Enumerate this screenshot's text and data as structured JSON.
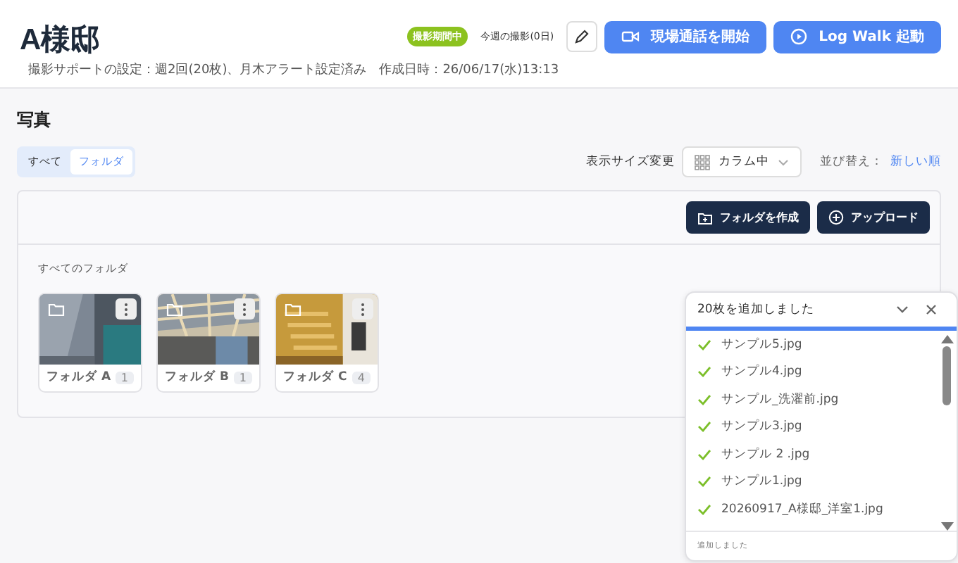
{
  "header": {
    "title": "A様邸",
    "status_badge": "撮影期間中",
    "week_badge": "今週の撮影(0日)",
    "subtitle": "撮影サポートの設定：週2回(20枚)、月木アラート設定済み　作成日時：26/06/17(水)13:13",
    "buttons": [
      {
        "label": "現場通話を開始",
        "kind": "video"
      },
      {
        "label": "Log Walk 起動",
        "kind": "play"
      }
    ]
  },
  "photos": {
    "title": "写真",
    "tabs": [
      {
        "label": "すべて",
        "selected": false
      },
      {
        "label": "フォルダ",
        "selected": true
      }
    ],
    "size_label": "表示サイズ変更",
    "size_select": "カラム中",
    "sort_label": "並び替え：",
    "sort_value": "新しい順",
    "actions": [
      {
        "label": "フォルダを作成",
        "kind": "folder"
      },
      {
        "label": "アップロード",
        "kind": "plus"
      }
    ],
    "folders_title": "すべてのフォルダ",
    "folders": [
      {
        "name": "フォルダ A",
        "count": "1"
      },
      {
        "name": "フォルダ B",
        "count": "1"
      },
      {
        "name": "フォルダ C",
        "count": "4"
      }
    ]
  },
  "upload": {
    "title": "20枚を追加しました",
    "level": 1,
    "files": [
      {
        "name": "サンプル5.jpg"
      },
      {
        "name": "サンプル4.jpg"
      },
      {
        "name": "サンプル_洗濯前.jpg"
      },
      {
        "name": "サンプル3.jpg"
      },
      {
        "name": "サンプル 2 .jpg"
      },
      {
        "name": "サンプル1.jpg"
      },
      {
        "name": "20260917_A様邸_洋室1.jpg"
      }
    ],
    "footer": "追加しました"
  }
}
